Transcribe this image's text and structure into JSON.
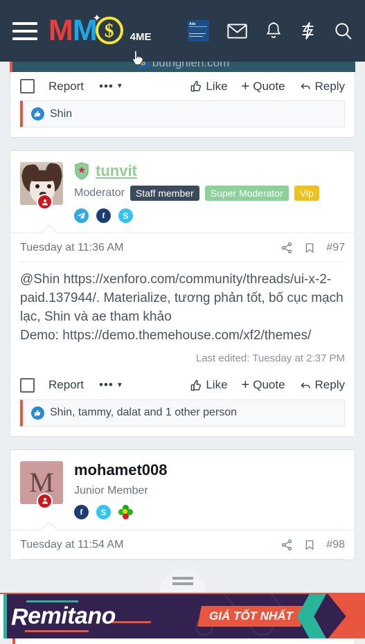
{
  "header": {
    "menu_icon": "hamburger-menu-icon",
    "logo": {
      "mm_red": "M",
      "mm_blue": "M",
      "dollar": "$",
      "suffix": "4ME"
    },
    "icons": [
      {
        "name": "ad-thumbnail-icon",
        "label": "Ads"
      },
      {
        "name": "mail-icon",
        "label": "Inbox"
      },
      {
        "name": "bell-icon",
        "label": "Alerts"
      },
      {
        "name": "lightning-icon",
        "label": "What's new"
      },
      {
        "name": "search-icon",
        "label": "Search"
      }
    ],
    "ad_thumb_text": "Ads"
  },
  "top_banner": {
    "site": "butnghien.com",
    "favicon_letter": "B"
  },
  "posts": [
    {
      "id": "post-96",
      "footer": {
        "report": "Report",
        "dots": "•••",
        "like": "Like",
        "quote": "Quote",
        "reply": "Reply"
      },
      "reactions": "Shin"
    },
    {
      "id": "post-97",
      "user": {
        "name": "tunvit",
        "title": "Moderator",
        "badges": [
          "Staff member",
          "Super Moderator",
          "Vip"
        ],
        "socials": [
          "telegram-icon",
          "facebook-icon",
          "skype-icon"
        ],
        "avatar_type": "photo"
      },
      "date": "Tuesday at 11:36 AM",
      "number": "#97",
      "body_parts": {
        "mention": "@Shin ",
        "link1": "https://xenforo.com/community/threads/ui-x-2-paid.137944/",
        "text1": ". Materialize, tương phản tốt, bố cục mạch lạc, Shin và ae tham khảo",
        "demo_label": "Demo: ",
        "link2": "https://demo.themehouse.com/xf2/themes/"
      },
      "last_edited": "Last edited: Tuesday at 2:37 PM",
      "footer": {
        "report": "Report",
        "dots": "•••",
        "like": "Like",
        "quote": "Quote",
        "reply": "Reply"
      },
      "reactions": "Shin, tammy, dalat and 1 other person"
    },
    {
      "id": "post-98",
      "user": {
        "name": "mohamet008",
        "title": "Junior Member",
        "badges": [],
        "socials": [
          "facebook-icon",
          "skype-icon",
          "icq-icon"
        ],
        "avatar_letter": "M",
        "avatar_type": "letter"
      },
      "date": "Tuesday at 11:54 AM",
      "number": "#98"
    }
  ],
  "ad": {
    "brand": "emitano",
    "brand_initial": "R",
    "tagline": "GIÁ TỐT NHẤT"
  },
  "colors": {
    "header_bg": "#2b3a4a",
    "accent_red": "#e8563f",
    "logo_red": "#ea3d3d",
    "logo_blue": "#1ea7e8",
    "logo_yellow": "#f5e72b",
    "badge_staff": "#3c4b5c",
    "badge_supmod": "#8cd199",
    "badge_vip": "#eec21c",
    "username_green": "#8dcf93",
    "ad_bg": "#332250",
    "ad_teal": "#28b59a"
  }
}
